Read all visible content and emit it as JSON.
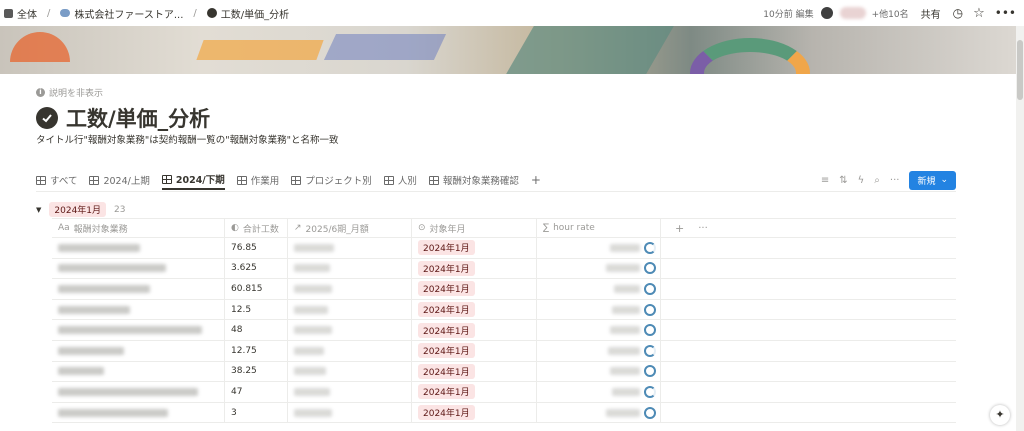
{
  "breadcrumb": {
    "root": "全体",
    "company": "株式会社ファーストア...",
    "page": "工数/単価_分析"
  },
  "topbar": {
    "edited": "10分前 編集",
    "others": "+他10名",
    "share": "共有"
  },
  "page": {
    "desc_toggle": "説明を非表示",
    "title": "工数/単価_分析",
    "description": "タイトル行\"報酬対象業務\"は契約報酬一覧の\"報酬対象業務\"と名称一致"
  },
  "views": [
    {
      "label": "すべて",
      "active": false
    },
    {
      "label": "2024/上期",
      "active": false
    },
    {
      "label": "2024/下期",
      "active": true
    },
    {
      "label": "作業用",
      "active": false
    },
    {
      "label": "プロジェクト別",
      "active": false
    },
    {
      "label": "人別",
      "active": false
    },
    {
      "label": "報酬対象業務確認",
      "active": false
    }
  ],
  "new_button": "新規",
  "group": {
    "label": "2024年1月",
    "count": "23"
  },
  "columns": {
    "name": "報酬対象業務",
    "hours": "合計工数",
    "amount": "2025/6期_月額",
    "month": "対象年月",
    "rate": "hour rate"
  },
  "rows": [
    {
      "hours": "76.85",
      "month": "2024年1月"
    },
    {
      "hours": "3.625",
      "month": "2024年1月"
    },
    {
      "hours": "60.815",
      "month": "2024年1月"
    },
    {
      "hours": "12.5",
      "month": "2024年1月"
    },
    {
      "hours": "48",
      "month": "2024年1月"
    },
    {
      "hours": "12.75",
      "month": "2024年1月"
    },
    {
      "hours": "38.25",
      "month": "2024年1月"
    },
    {
      "hours": "47",
      "month": "2024年1月"
    },
    {
      "hours": "3",
      "month": "2024年1月"
    }
  ],
  "colors": {
    "accent": "#2383e2",
    "tag_bg": "#fbe4e4",
    "tag_text": "#5d1715",
    "ring": "#4d8ab5"
  }
}
